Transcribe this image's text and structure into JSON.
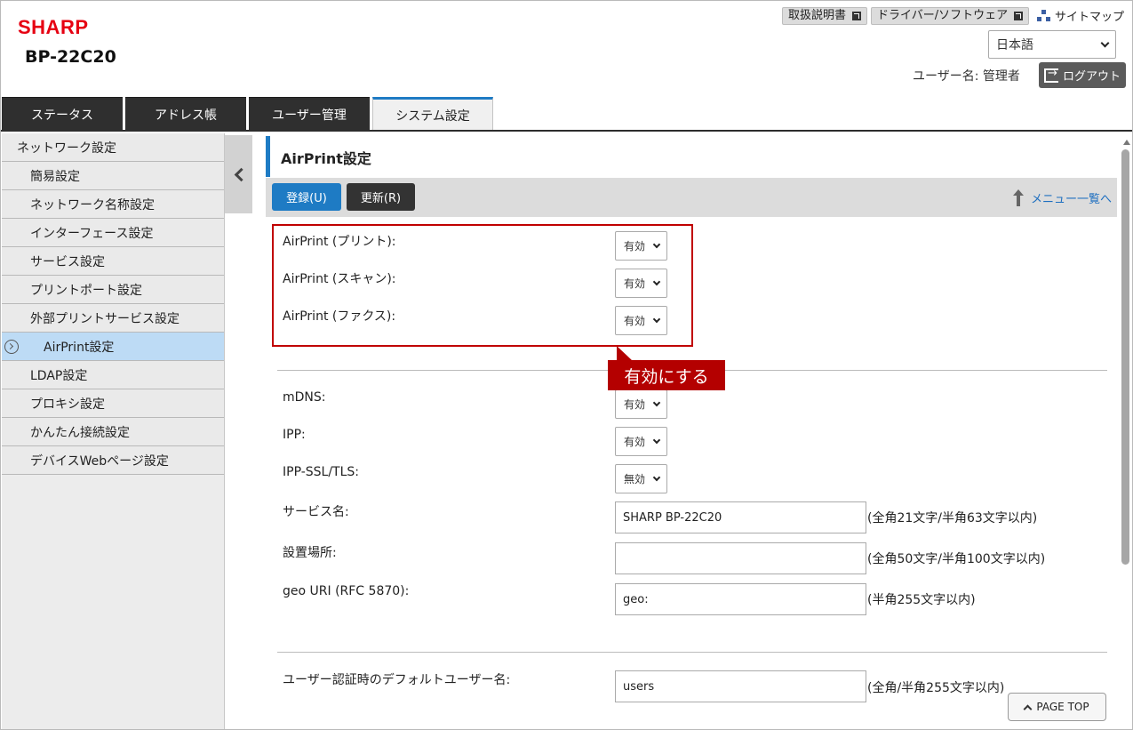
{
  "header": {
    "brand": "SHARP",
    "model": "BP-22C20",
    "manual_label": "取扱説明書",
    "driver_label": "ドライバー/ソフトウェア",
    "sitemap_label": "サイトマップ",
    "language": "日本語",
    "user_label": "ユーザー名: 管理者",
    "logout_label": "ログアウト"
  },
  "tabs": [
    {
      "label": "ステータス"
    },
    {
      "label": "アドレス帳"
    },
    {
      "label": "ユーザー管理"
    },
    {
      "label": "システム設定"
    }
  ],
  "sidebar": {
    "items": [
      {
        "label": "ネットワーク設定"
      },
      {
        "label": "簡易設定"
      },
      {
        "label": "ネットワーク名称設定"
      },
      {
        "label": "インターフェース設定"
      },
      {
        "label": "サービス設定"
      },
      {
        "label": "プリントポート設定"
      },
      {
        "label": "外部プリントサービス設定"
      },
      {
        "label": "AirPrint設定"
      },
      {
        "label": "LDAP設定"
      },
      {
        "label": "プロキシ設定"
      },
      {
        "label": "かんたん接続設定"
      },
      {
        "label": "デバイスWebページ設定"
      }
    ]
  },
  "main": {
    "title": "AirPrint設定",
    "save_label": "登録(U)",
    "refresh_label": "更新(R)",
    "menu_link": "メニュー一覧へ",
    "callout": "有効にする",
    "page_top": "PAGE TOP",
    "airprint": [
      {
        "label": "AirPrint (プリント):",
        "value": "有効"
      },
      {
        "label": "AirPrint (スキャン):",
        "value": "有効"
      },
      {
        "label": "AirPrint (ファクス):",
        "value": "有効"
      }
    ],
    "services": [
      {
        "label": "mDNS:",
        "value": "有効"
      },
      {
        "label": "IPP:",
        "value": "有効"
      },
      {
        "label": "IPP-SSL/TLS:",
        "value": "無効"
      }
    ],
    "fields": [
      {
        "label": "サービス名:",
        "value": "SHARP BP-22C20",
        "hint": "(全角21文字/半角63文字以内)"
      },
      {
        "label": "設置場所:",
        "value": "",
        "hint": "(全角50文字/半角100文字以内)"
      },
      {
        "label": "geo URI (RFC 5870):",
        "value": "geo:",
        "hint": "(半角255文字以内)"
      },
      {
        "label": "ユーザー認証時のデフォルトユーザー名:",
        "value": "users",
        "hint": "(全角/半角255文字以内)"
      }
    ]
  }
}
